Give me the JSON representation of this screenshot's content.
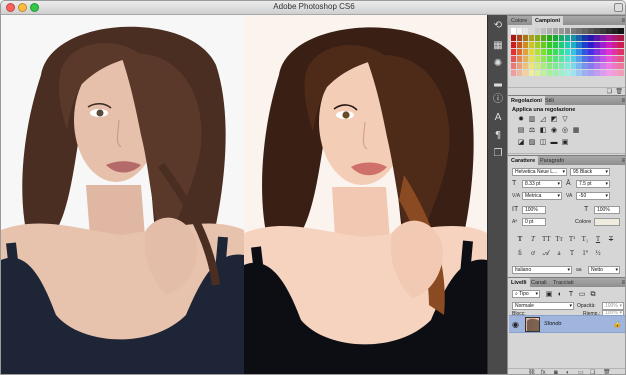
{
  "window": {
    "title": "Adobe Photoshop CS6"
  },
  "canvas": {
    "before_image": "portrait-original",
    "after_image": "portrait-retouched"
  },
  "toolstrip": {
    "icons": [
      "history-icon",
      "swatches-icon",
      "adjustments-icon",
      "histogram-icon",
      "info-icon",
      "character-icon",
      "paragraph-icon",
      "layers-icon"
    ]
  },
  "swatches_panel": {
    "tabs": [
      "Colore",
      "Campioni"
    ],
    "active_tab": "Campioni"
  },
  "adjustments_panel": {
    "tabs": [
      "Regolazioni",
      "Stili"
    ],
    "active_tab": "Regolazioni",
    "heading": "Applica una regolazione"
  },
  "character_panel": {
    "tabs": [
      "Carattere",
      "Paragrafo"
    ],
    "active_tab": "Carattere",
    "font_family": "Helvetica Neue L...",
    "font_style": "95 Black",
    "font_size": "8.33 pt",
    "leading": "7.5 pt",
    "kerning": "Metrica",
    "tracking": "-50",
    "vertical_scale": "100%",
    "horizontal_scale": "100%",
    "baseline_shift": "0 pt",
    "color_label": "Colore",
    "language": "Italiano",
    "antialias": "Netto"
  },
  "layers_panel": {
    "tabs": [
      "Livelli",
      "Canali",
      "Tracciati"
    ],
    "active_tab": "Livelli",
    "filter_label": "Tipo",
    "blend_mode": "Normale",
    "opacity_label": "Opacità:",
    "opacity_value": "100%",
    "lock_label": "Blocc:",
    "fill_label": "Riemp.:",
    "fill_value": "100%",
    "layer_name": "Sfondo"
  },
  "colors": {
    "accent_selection": "#9fb5dd",
    "panel_bg": "#d6d6d6",
    "toolstrip_bg": "#4a4a4a"
  }
}
